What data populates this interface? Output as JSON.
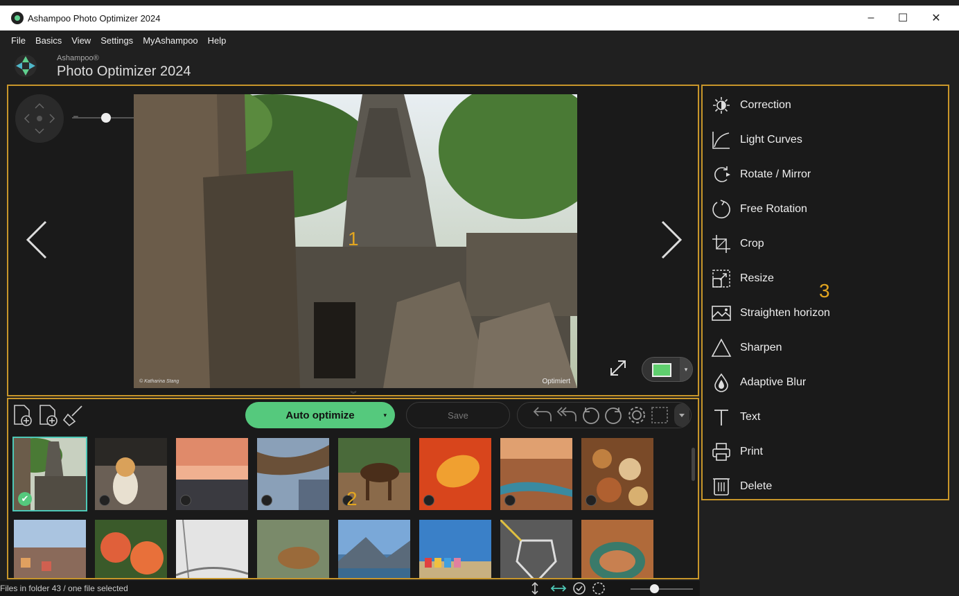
{
  "window": {
    "title": "Ashampoo Photo Optimizer 2024",
    "minimize": "–",
    "maximize": "☐",
    "close": "✕"
  },
  "menu": [
    "File",
    "Basics",
    "View",
    "Settings",
    "MyAshampoo",
    "Help"
  ],
  "brand": {
    "small": "Ashampoo®",
    "big": "Photo Optimizer 2024"
  },
  "viewer": {
    "photo_credit": "© Katharina Stang",
    "photo_state": "Optimiert",
    "overlay_number": "1",
    "zoom_minus": "–",
    "zoom_plus": "+",
    "prev": "‹",
    "next": "›"
  },
  "toolbar": {
    "auto_optimize": "Auto optimize",
    "save": "Save",
    "overlay_number": "2"
  },
  "thumbnails_row1": [
    {
      "selected": true,
      "color": "#5a6b4a"
    },
    {
      "selected": false,
      "color": "#8a7a66"
    },
    {
      "selected": false,
      "color": "#c57a5a"
    },
    {
      "selected": false,
      "color": "#6b5a45"
    },
    {
      "selected": false,
      "color": "#7a6040"
    },
    {
      "selected": false,
      "color": "#d8551c"
    },
    {
      "selected": false,
      "color": "#a36a48"
    },
    {
      "selected": false,
      "color": "#8a5a30"
    }
  ],
  "thumbnails_row2": [
    {
      "color": "#6a82a4"
    },
    {
      "color": "#d66a4a"
    },
    {
      "color": "#d8d8d8"
    },
    {
      "color": "#6b7a55"
    },
    {
      "color": "#4a7aa8"
    },
    {
      "color": "#3a78b8"
    },
    {
      "color": "#666666"
    },
    {
      "color": "#a65a30"
    }
  ],
  "status": {
    "text": "Files in folder 43 / one file selected"
  },
  "right_panel": {
    "overlay_number": "3",
    "tools": [
      {
        "label": "Correction",
        "icon": "sun-icon"
      },
      {
        "label": "Light Curves",
        "icon": "curve-icon"
      },
      {
        "label": "Rotate / Mirror",
        "icon": "rotate-mirror-icon"
      },
      {
        "label": "Free Rotation",
        "icon": "free-rotation-icon"
      },
      {
        "label": "Crop",
        "icon": "crop-icon"
      },
      {
        "label": "Resize",
        "icon": "resize-icon"
      },
      {
        "label": "Straighten horizon",
        "icon": "horizon-icon"
      },
      {
        "label": "Sharpen",
        "icon": "triangle-icon"
      },
      {
        "label": "Adaptive Blur",
        "icon": "drop-icon"
      },
      {
        "label": "Text",
        "icon": "text-icon"
      },
      {
        "label": "Print",
        "icon": "printer-icon"
      },
      {
        "label": "Delete",
        "icon": "trash-icon"
      }
    ]
  },
  "colors": {
    "accent": "#55c97d",
    "highlight_frame": "#c8962a",
    "selection": "#4ec9b7"
  }
}
